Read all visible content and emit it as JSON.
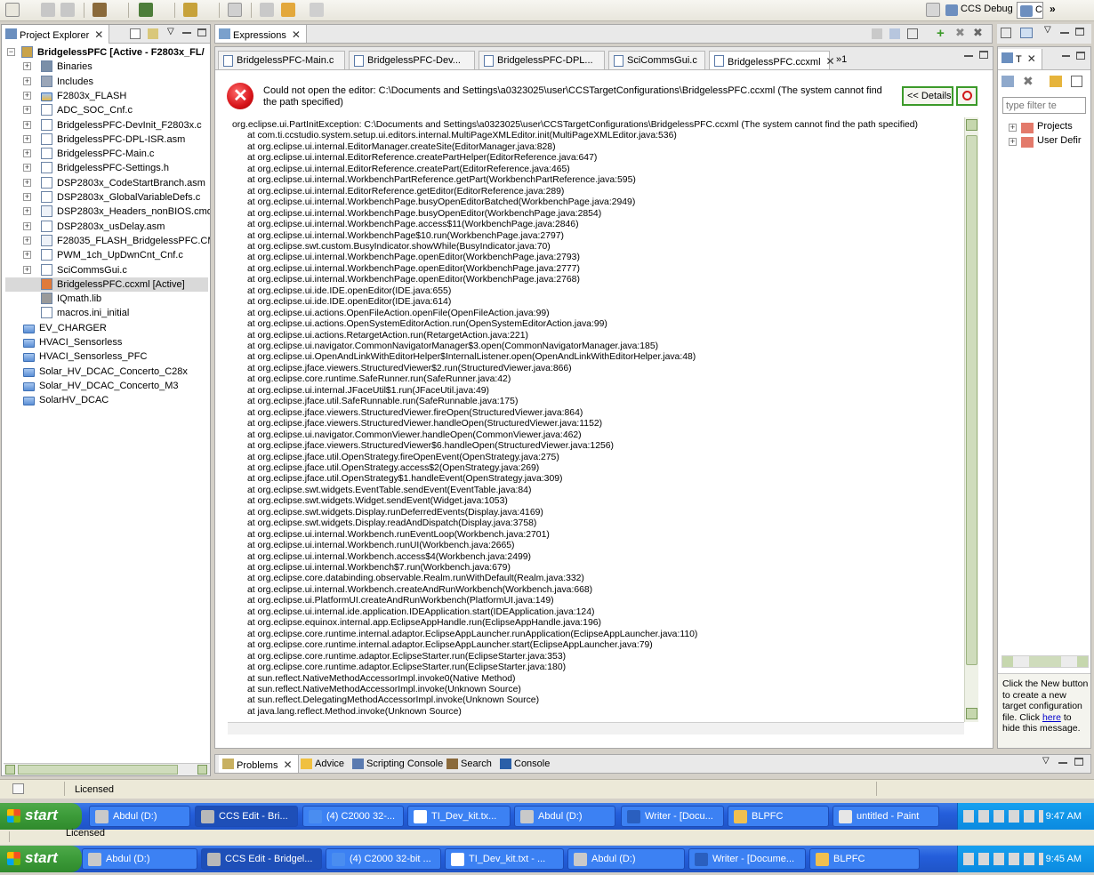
{
  "perspectives": {
    "debug": "CCS Debug",
    "edit_trunc": "C",
    "more": "»"
  },
  "project_explorer": {
    "tab_label": "Project Explorer",
    "items": [
      {
        "label": "BridgelessPFC [Active - F2803x_FL/",
        "indent": 0,
        "bold": true,
        "expand": "−",
        "icon": "project"
      },
      {
        "label": "Binaries",
        "indent": 1,
        "expand": "+",
        "icon": "binaries"
      },
      {
        "label": "Includes",
        "indent": 1,
        "expand": "+",
        "icon": "includes"
      },
      {
        "label": "F2803x_FLASH",
        "indent": 1,
        "expand": "+",
        "icon": "folder-open"
      },
      {
        "label": "ADC_SOC_Cnf.c",
        "indent": 1,
        "expand": "+",
        "icon": "c-file"
      },
      {
        "label": "BridgelessPFC-DevInit_F2803x.c",
        "indent": 1,
        "expand": "+",
        "icon": "c-file"
      },
      {
        "label": "BridgelessPFC-DPL-ISR.asm",
        "indent": 1,
        "expand": "+",
        "icon": "asm-file"
      },
      {
        "label": "BridgelessPFC-Main.c",
        "indent": 1,
        "expand": "+",
        "icon": "c-file"
      },
      {
        "label": "BridgelessPFC-Settings.h",
        "indent": 1,
        "expand": "+",
        "icon": "h-file"
      },
      {
        "label": "DSP2803x_CodeStartBranch.asm",
        "indent": 1,
        "expand": "+",
        "icon": "asm-file"
      },
      {
        "label": "DSP2803x_GlobalVariableDefs.c",
        "indent": 1,
        "expand": "+",
        "icon": "c-file"
      },
      {
        "label": "DSP2803x_Headers_nonBIOS.cmd",
        "indent": 1,
        "expand": "+",
        "icon": "cmd-file"
      },
      {
        "label": "DSP2803x_usDelay.asm",
        "indent": 1,
        "expand": "+",
        "icon": "asm-file"
      },
      {
        "label": "F28035_FLASH_BridgelessPFC.CMD",
        "indent": 1,
        "expand": "+",
        "icon": "cmd-file"
      },
      {
        "label": "PWM_1ch_UpDwnCnt_Cnf.c",
        "indent": 1,
        "expand": "+",
        "icon": "c-file"
      },
      {
        "label": "SciCommsGui.c",
        "indent": 1,
        "expand": "+",
        "icon": "c-file"
      },
      {
        "label": "BridgelessPFC.ccxml [Active]",
        "indent": 1,
        "expand": "",
        "icon": "ccxml-file",
        "selected": true
      },
      {
        "label": "IQmath.lib",
        "indent": 1,
        "expand": "",
        "icon": "lib-file"
      },
      {
        "label": "macros.ini_initial",
        "indent": 1,
        "expand": "",
        "icon": "text-file"
      },
      {
        "label": "EV_CHARGER",
        "indent": 0,
        "expand": "",
        "icon": "closed-project"
      },
      {
        "label": "HVACI_Sensorless",
        "indent": 0,
        "expand": "",
        "icon": "closed-project"
      },
      {
        "label": "HVACI_Sensorless_PFC",
        "indent": 0,
        "expand": "",
        "icon": "closed-project"
      },
      {
        "label": "Solar_HV_DCAC_Concerto_C28x",
        "indent": 0,
        "expand": "",
        "icon": "closed-project"
      },
      {
        "label": "Solar_HV_DCAC_Concerto_M3",
        "indent": 0,
        "expand": "",
        "icon": "closed-project"
      },
      {
        "label": "SolarHV_DCAC",
        "indent": 0,
        "expand": "",
        "icon": "closed-project"
      }
    ]
  },
  "expressions_tab": "Expressions",
  "editor_tabs": [
    {
      "label": "BridgelessPFC-Main.c"
    },
    {
      "label": "BridgelessPFC-Dev..."
    },
    {
      "label": "BridgelessPFC-DPL..."
    },
    {
      "label": "SciCommsGui.c"
    },
    {
      "label": "BridgelessPFC.ccxml",
      "active": true
    }
  ],
  "editor_overflow": "»1",
  "error": {
    "message": "Could not open the editor: C:\\Documents and Settings\\a0323025\\user\\CCSTargetConfigurations\\BridgelessPFC.ccxml (The system cannot find the path specified)",
    "details_button": "<< Details"
  },
  "stack_trace": [
    "org.eclipse.ui.PartInitException: C:\\Documents and Settings\\a0323025\\user\\CCSTargetConfigurations\\BridgelessPFC.ccxml (The system cannot find the path specified)",
    "at com.ti.ccstudio.system.setup.ui.editors.internal.MultiPageXMLEditor.init(MultiPageXMLEditor.java:536)",
    "at org.eclipse.ui.internal.EditorManager.createSite(EditorManager.java:828)",
    "at org.eclipse.ui.internal.EditorReference.createPartHelper(EditorReference.java:647)",
    "at org.eclipse.ui.internal.EditorReference.createPart(EditorReference.java:465)",
    "at org.eclipse.ui.internal.WorkbenchPartReference.getPart(WorkbenchPartReference.java:595)",
    "at org.eclipse.ui.internal.EditorReference.getEditor(EditorReference.java:289)",
    "at org.eclipse.ui.internal.WorkbenchPage.busyOpenEditorBatched(WorkbenchPage.java:2949)",
    "at org.eclipse.ui.internal.WorkbenchPage.busyOpenEditor(WorkbenchPage.java:2854)",
    "at org.eclipse.ui.internal.WorkbenchPage.access$11(WorkbenchPage.java:2846)",
    "at org.eclipse.ui.internal.WorkbenchPage$10.run(WorkbenchPage.java:2797)",
    "at org.eclipse.swt.custom.BusyIndicator.showWhile(BusyIndicator.java:70)",
    "at org.eclipse.ui.internal.WorkbenchPage.openEditor(WorkbenchPage.java:2793)",
    "at org.eclipse.ui.internal.WorkbenchPage.openEditor(WorkbenchPage.java:2777)",
    "at org.eclipse.ui.internal.WorkbenchPage.openEditor(WorkbenchPage.java:2768)",
    "at org.eclipse.ui.ide.IDE.openEditor(IDE.java:655)",
    "at org.eclipse.ui.ide.IDE.openEditor(IDE.java:614)",
    "at org.eclipse.ui.actions.OpenFileAction.openFile(OpenFileAction.java:99)",
    "at org.eclipse.ui.actions.OpenSystemEditorAction.run(OpenSystemEditorAction.java:99)",
    "at org.eclipse.ui.actions.RetargetAction.run(RetargetAction.java:221)",
    "at org.eclipse.ui.navigator.CommonNavigatorManager$3.open(CommonNavigatorManager.java:185)",
    "at org.eclipse.ui.OpenAndLinkWithEditorHelper$InternalListener.open(OpenAndLinkWithEditorHelper.java:48)",
    "at org.eclipse.jface.viewers.StructuredViewer$2.run(StructuredViewer.java:866)",
    "at org.eclipse.core.runtime.SafeRunner.run(SafeRunner.java:42)",
    "at org.eclipse.ui.internal.JFaceUtil$1.run(JFaceUtil.java:49)",
    "at org.eclipse.jface.util.SafeRunnable.run(SafeRunnable.java:175)",
    "at org.eclipse.jface.viewers.StructuredViewer.fireOpen(StructuredViewer.java:864)",
    "at org.eclipse.jface.viewers.StructuredViewer.handleOpen(StructuredViewer.java:1152)",
    "at org.eclipse.ui.navigator.CommonViewer.handleOpen(CommonViewer.java:462)",
    "at org.eclipse.jface.viewers.StructuredViewer$6.handleOpen(StructuredViewer.java:1256)",
    "at org.eclipse.jface.util.OpenStrategy.fireOpenEvent(OpenStrategy.java:275)",
    "at org.eclipse.jface.util.OpenStrategy.access$2(OpenStrategy.java:269)",
    "at org.eclipse.jface.util.OpenStrategy$1.handleEvent(OpenStrategy.java:309)",
    "at org.eclipse.swt.widgets.EventTable.sendEvent(EventTable.java:84)",
    "at org.eclipse.swt.widgets.Widget.sendEvent(Widget.java:1053)",
    "at org.eclipse.swt.widgets.Display.runDeferredEvents(Display.java:4169)",
    "at org.eclipse.swt.widgets.Display.readAndDispatch(Display.java:3758)",
    "at org.eclipse.ui.internal.Workbench.runEventLoop(Workbench.java:2701)",
    "at org.eclipse.ui.internal.Workbench.runUI(Workbench.java:2665)",
    "at org.eclipse.ui.internal.Workbench.access$4(Workbench.java:2499)",
    "at org.eclipse.ui.internal.Workbench$7.run(Workbench.java:679)",
    "at org.eclipse.core.databinding.observable.Realm.runWithDefault(Realm.java:332)",
    "at org.eclipse.ui.internal.Workbench.createAndRunWorkbench(Workbench.java:668)",
    "at org.eclipse.ui.PlatformUI.createAndRunWorkbench(PlatformUI.java:149)",
    "at org.eclipse.ui.internal.ide.application.IDEApplication.start(IDEApplication.java:124)",
    "at org.eclipse.equinox.internal.app.EclipseAppHandle.run(EclipseAppHandle.java:196)",
    "at org.eclipse.core.runtime.internal.adaptor.EclipseAppLauncher.runApplication(EclipseAppLauncher.java:110)",
    "at org.eclipse.core.runtime.internal.adaptor.EclipseAppLauncher.start(EclipseAppLauncher.java:79)",
    "at org.eclipse.core.runtime.adaptor.EclipseStarter.run(EclipseStarter.java:353)",
    "at org.eclipse.core.runtime.adaptor.EclipseStarter.run(EclipseStarter.java:180)",
    "at sun.reflect.NativeMethodAccessorImpl.invoke0(Native Method)",
    "at sun.reflect.NativeMethodAccessorImpl.invoke(Unknown Source)",
    "at sun.reflect.DelegatingMethodAccessorImpl.invoke(Unknown Source)",
    "at java.lang.reflect.Method.invoke(Unknown Source)"
  ],
  "right_panel": {
    "tab_label": "T",
    "filter_placeholder": "type filter te",
    "tree": [
      {
        "label": "Projects"
      },
      {
        "label": "User Defir"
      }
    ],
    "help_before": "Click the New button to create a new target configuration file. Click ",
    "help_link": "here",
    "help_after": " to hide this message."
  },
  "bottom_tabs": [
    {
      "label": "Problems",
      "active": true,
      "icon": "problems"
    },
    {
      "label": "Advice",
      "icon": "advice"
    },
    {
      "label": "Scripting Console",
      "icon": "scripting-console"
    },
    {
      "label": "Search",
      "icon": "search"
    },
    {
      "label": "Console",
      "icon": "console"
    }
  ],
  "status": {
    "licensed": "Licensed"
  },
  "taskbar_top": {
    "start": "start",
    "tasks": [
      "Abdul (D:)",
      "CCS Edit - Bri...",
      "(4) C2000 32-...",
      "TI_Dev_kit.tx...",
      "Abdul (D:)",
      "Writer - [Docu...",
      "BLPFC",
      "untitled - Paint"
    ],
    "time": "9:47 AM"
  },
  "taskbar_bottom": {
    "start": "start",
    "tasks": [
      "Abdul (D:)",
      "CCS Edit - Bridgel...",
      "(4) C2000 32-bit ...",
      "TI_Dev_kit.txt - ...",
      "Abdul (D:)",
      "Writer - [Docume...",
      "BLPFC"
    ],
    "time": "9:45 AM"
  },
  "colors": {
    "accent": "#1f54c6",
    "error_red": "#d7141a",
    "start_green": "#3d9c3a"
  }
}
